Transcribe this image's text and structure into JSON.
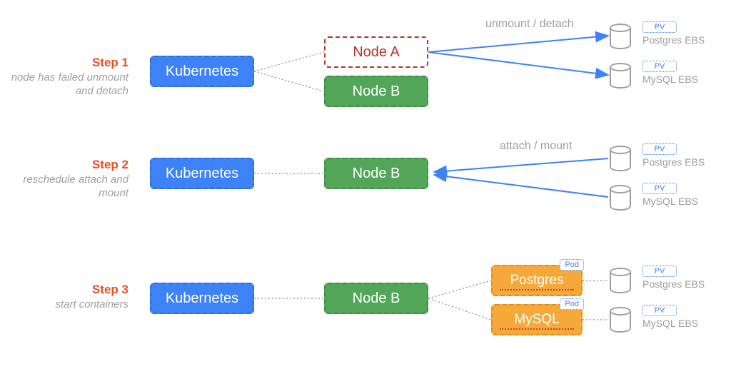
{
  "steps": [
    {
      "title": "Step 1",
      "sub": "node has failed unmount and detach",
      "action": "unmount / detach"
    },
    {
      "title": "Step 2",
      "sub": "reschedule attach and mount",
      "action": "attach / mount"
    },
    {
      "title": "Step 3",
      "sub": "start containers",
      "action": ""
    }
  ],
  "labels": {
    "kubernetes": "Kubernetes",
    "node_a": "Node A",
    "node_b": "Node B",
    "postgres": "Postgres",
    "mysql": "MySQL",
    "pod": "Pod",
    "pv": "PV",
    "postgres_ebs": "Postgres EBS",
    "mysql_ebs": "MySQL EBS"
  }
}
